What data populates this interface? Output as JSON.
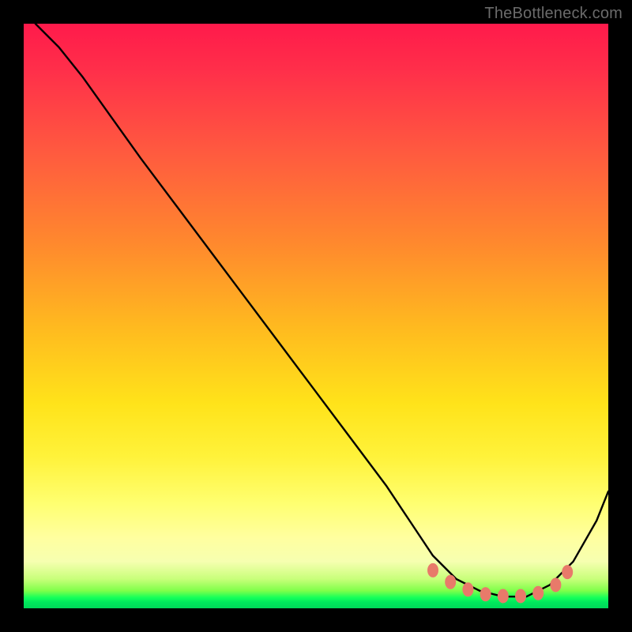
{
  "watermark": "TheBottleneck.com",
  "chart_data": {
    "type": "line",
    "title": "",
    "xlabel": "",
    "ylabel": "",
    "xlim": [
      0,
      100
    ],
    "ylim": [
      0,
      100
    ],
    "grid": false,
    "legend": false,
    "series": [
      {
        "name": "curve",
        "color": "#000000",
        "x": [
          2,
          6,
          10,
          15,
          20,
          26,
          32,
          38,
          44,
          50,
          56,
          62,
          66,
          70,
          74,
          78,
          82,
          86,
          90,
          94,
          98,
          100
        ],
        "y": [
          100,
          96,
          91,
          84,
          77,
          69,
          61,
          53,
          45,
          37,
          29,
          21,
          15,
          9,
          5,
          3,
          2,
          2,
          4,
          8,
          15,
          20
        ]
      }
    ],
    "markers": {
      "name": "highlight-dots",
      "color": "#e87a6a",
      "x": [
        70,
        73,
        76,
        79,
        82,
        85,
        88,
        91,
        93
      ],
      "y": [
        6.5,
        4.5,
        3.2,
        2.4,
        2.1,
        2.1,
        2.6,
        4.0,
        6.2
      ]
    },
    "gradient_stops": [
      {
        "pos": 0,
        "color": "#ff1a4b"
      },
      {
        "pos": 22,
        "color": "#ff5a3f"
      },
      {
        "pos": 52,
        "color": "#ffba1f"
      },
      {
        "pos": 82,
        "color": "#ffff70"
      },
      {
        "pos": 97,
        "color": "#7fff4a"
      },
      {
        "pos": 100,
        "color": "#00d85a"
      }
    ]
  }
}
